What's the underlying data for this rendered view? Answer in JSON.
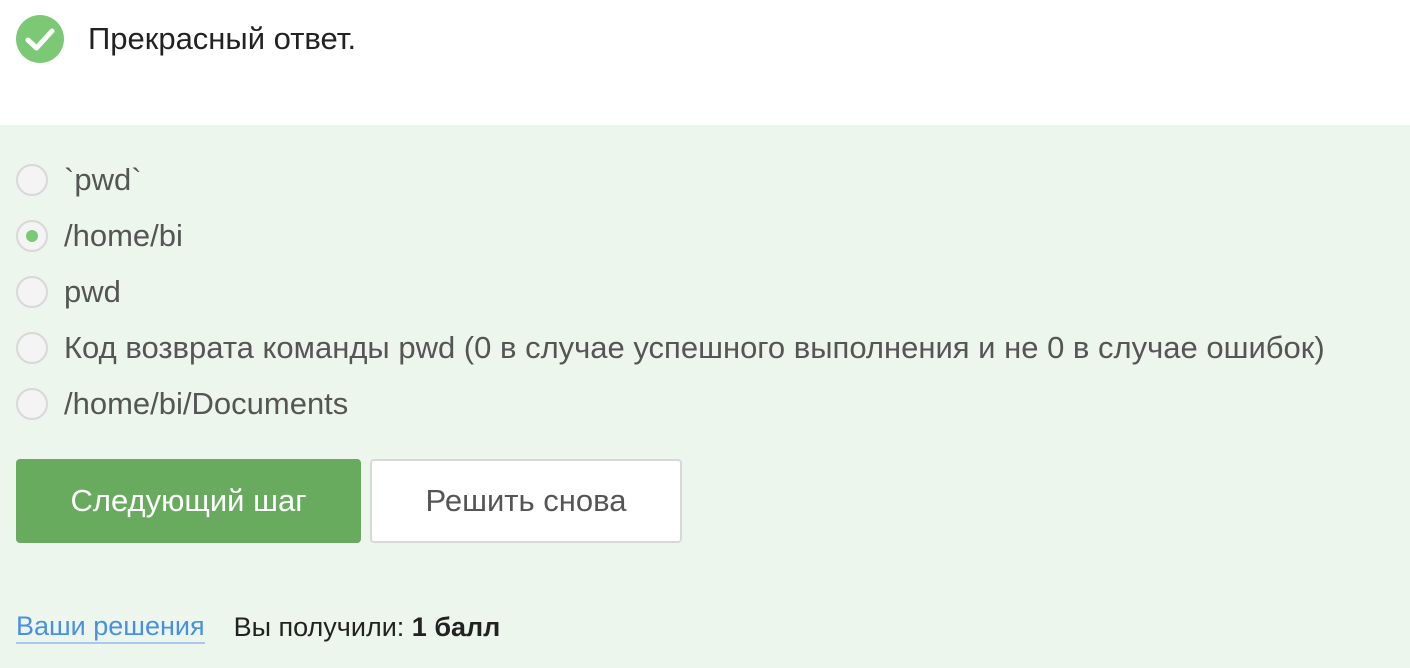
{
  "feedback": {
    "icon": "check-circle-icon",
    "icon_color": "#7bc974",
    "message": "Прекрасный ответ."
  },
  "quiz": {
    "background": "#edf6ec",
    "options": [
      {
        "label": "`pwd`",
        "selected": false
      },
      {
        "label": "/home/bi",
        "selected": true
      },
      {
        "label": "pwd",
        "selected": false
      },
      {
        "label": "Код возврата команды pwd (0 в случае успешного выполнения и не 0 в случае ошибок)",
        "selected": false
      },
      {
        "label": "/home/bi/Documents",
        "selected": false
      }
    ]
  },
  "actions": {
    "next_label": "Следующий шаг",
    "retry_label": "Решить снова",
    "primary_color": "#68ab5f"
  },
  "footer": {
    "solutions_link": "Ваши решения",
    "score_prefix": "Вы получили: ",
    "score_value": "1 балл"
  }
}
